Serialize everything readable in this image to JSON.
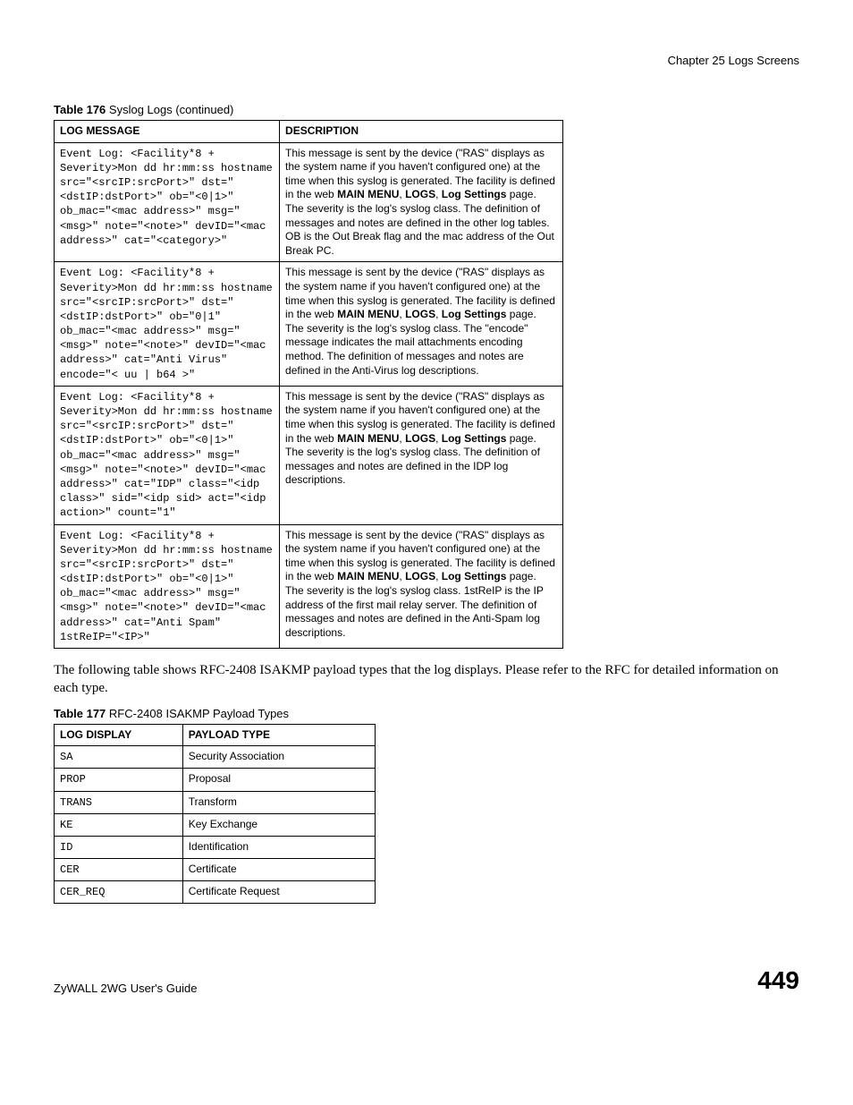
{
  "header": {
    "chapter": "Chapter 25 Logs Screens"
  },
  "table176": {
    "caption_bold": "Table 176",
    "caption_rest": "   Syslog Logs (continued)",
    "head": {
      "col1": "LOG MESSAGE",
      "col2": "DESCRIPTION"
    },
    "rows": [
      {
        "log": "Event Log: <Facility*8 + Severity>Mon dd hr:mm:ss hostname src=\"<srcIP:srcPort>\" dst=\"<dstIP:dstPort>\" ob=\"<0|1>\" ob_mac=\"<mac address>\" msg=\"<msg>\" note=\"<note>\" devID=\"<mac address>\" cat=\"<category>\"",
        "desc": "This message is sent by the device (\"RAS\" displays as the system name if you haven't configured one) at the time when this syslog is generated. The facility is defined in the web <b>MAIN MENU</b>, <b>LOGS</b>, <b>Log Settings</b> page. The severity is the log's syslog class. The definition of messages and notes are defined in the other log tables. OB is the Out Break flag and the mac address of the Out Break PC."
      },
      {
        "log": "Event Log: <Facility*8 + Severity>Mon dd hr:mm:ss hostname src=\"<srcIP:srcPort>\" dst=\"<dstIP:dstPort>\" ob=\"0|1\" ob_mac=\"<mac address>\" msg=\"<msg>\" note=\"<note>\" devID=\"<mac address>\" cat=\"Anti Virus\" encode=\"< uu | b64 >\"",
        "desc": "This message is sent by the device (\"RAS\" displays as the system name if you haven't configured one) at the time when this syslog is generated. The facility is defined in the web <b>MAIN MENU</b>, <b>LOGS</b>, <b>Log Settings</b> page. The severity is the log's syslog class. The \"encode\" message indicates the mail attachments encoding method. The definition of messages and notes are defined in the Anti-Virus log descriptions."
      },
      {
        "log": "Event Log: <Facility*8 + Severity>Mon dd hr:mm:ss hostname src=\"<srcIP:srcPort>\" dst=\"<dstIP:dstPort>\" ob=\"<0|1>\" ob_mac=\"<mac address>\" msg=\"<msg>\" note=\"<note>\" devID=\"<mac address>\" cat=\"IDP\" class=\"<idp class>\" sid=\"<idp sid> act=\"<idp action>\" count=\"1\"",
        "desc": "This message is sent by the device (\"RAS\" displays as the system name if you haven't configured one) at the time when this syslog is generated. The facility is defined in the web <b>MAIN MENU</b>, <b>LOGS</b>, <b>Log Settings</b> page. The severity is the log's syslog class. The definition of messages and notes are defined in the IDP log descriptions."
      },
      {
        "log": "Event Log: <Facility*8 + Severity>Mon dd hr:mm:ss hostname src=\"<srcIP:srcPort>\" dst=\"<dstIP:dstPort>\" ob=\"<0|1>\" ob_mac=\"<mac address>\" msg=\"<msg>\" note=\"<note>\" devID=\"<mac address>\" cat=\"Anti Spam\" 1stReIP=\"<IP>\"",
        "desc": "This message is sent by the device (\"RAS\" displays as the system name if you haven't configured one) at the time when this syslog is generated. The facility is defined in the web <b>MAIN MENU</b>, <b>LOGS</b>, <b>Log Settings</b> page. The severity is the log's syslog class. 1stReIP is the IP address of the first mail relay server. The definition of messages and notes are defined in the Anti-Spam log descriptions."
      }
    ]
  },
  "body_text": "The following table shows RFC-2408 ISAKMP payload types that the log displays. Please refer to the RFC for detailed information on each type.",
  "table177": {
    "caption_bold": "Table 177",
    "caption_rest": "   RFC-2408 ISAKMP Payload Types",
    "head": {
      "col1": "LOG DISPLAY",
      "col2": "PAYLOAD TYPE"
    },
    "rows": [
      {
        "disp": "SA",
        "pay": "Security Association"
      },
      {
        "disp": "PROP",
        "pay": "Proposal"
      },
      {
        "disp": "TRANS",
        "pay": "Transform"
      },
      {
        "disp": "KE",
        "pay": "Key Exchange"
      },
      {
        "disp": "ID",
        "pay": "Identification"
      },
      {
        "disp": "CER",
        "pay": "Certificate"
      },
      {
        "disp": "CER_REQ",
        "pay": "Certificate Request"
      }
    ]
  },
  "footer": {
    "left": "ZyWALL 2WG User's Guide",
    "right": "449"
  }
}
